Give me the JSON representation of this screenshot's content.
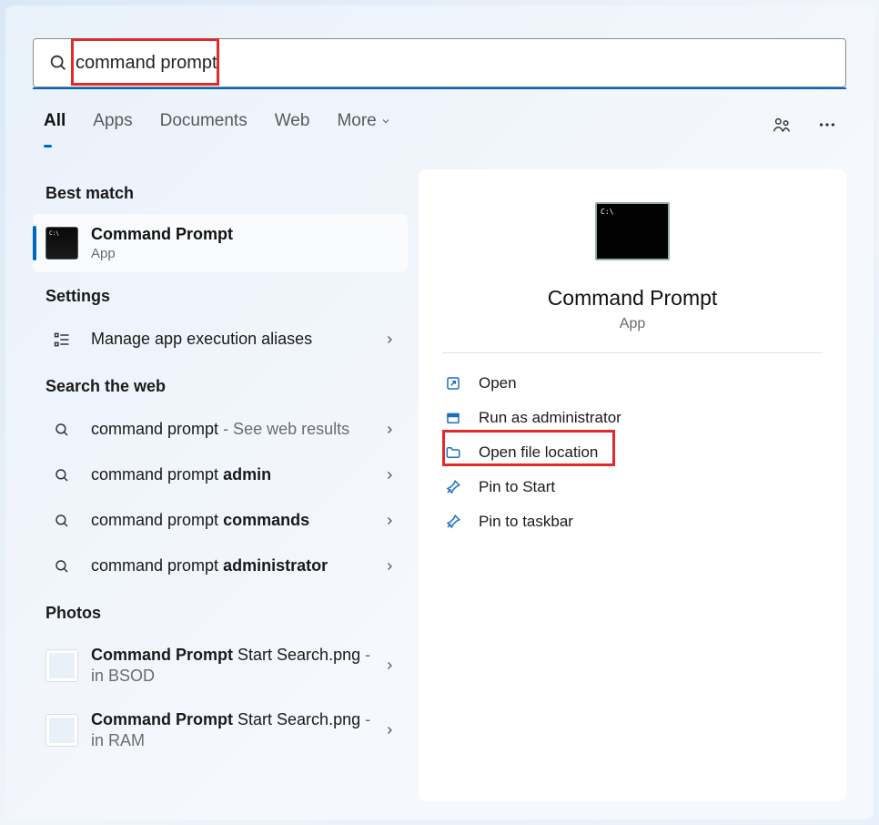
{
  "search": {
    "value": "command prompt"
  },
  "tabs": [
    "All",
    "Apps",
    "Documents",
    "Web",
    "More"
  ],
  "active_tab": "All",
  "left": {
    "best_match_header": "Best match",
    "best_match": {
      "title": "Command Prompt",
      "subtitle": "App"
    },
    "settings_header": "Settings",
    "settings_items": [
      {
        "label": "Manage app execution aliases"
      }
    ],
    "web_header": "Search the web",
    "web_items": [
      {
        "prefix": "command prompt",
        "bold": "",
        "suffix": " - See web results"
      },
      {
        "prefix": "command prompt ",
        "bold": "admin",
        "suffix": ""
      },
      {
        "prefix": "command prompt ",
        "bold": "commands",
        "suffix": ""
      },
      {
        "prefix": "command prompt ",
        "bold": "administrator",
        "suffix": ""
      }
    ],
    "photos_header": "Photos",
    "photo_items": [
      {
        "title_bold": "Command Prompt",
        "title_rest": " Start Search.png",
        "location": " - in BSOD"
      },
      {
        "title_bold": "Command Prompt",
        "title_rest": " Start Search.png",
        "location": " - in RAM"
      }
    ]
  },
  "right": {
    "title": "Command Prompt",
    "subtitle": "App",
    "actions": [
      {
        "icon": "open-external",
        "label": "Open"
      },
      {
        "icon": "shield",
        "label": "Run as administrator"
      },
      {
        "icon": "folder",
        "label": "Open file location"
      },
      {
        "icon": "pin",
        "label": "Pin to Start"
      },
      {
        "icon": "pin",
        "label": "Pin to taskbar"
      }
    ]
  }
}
